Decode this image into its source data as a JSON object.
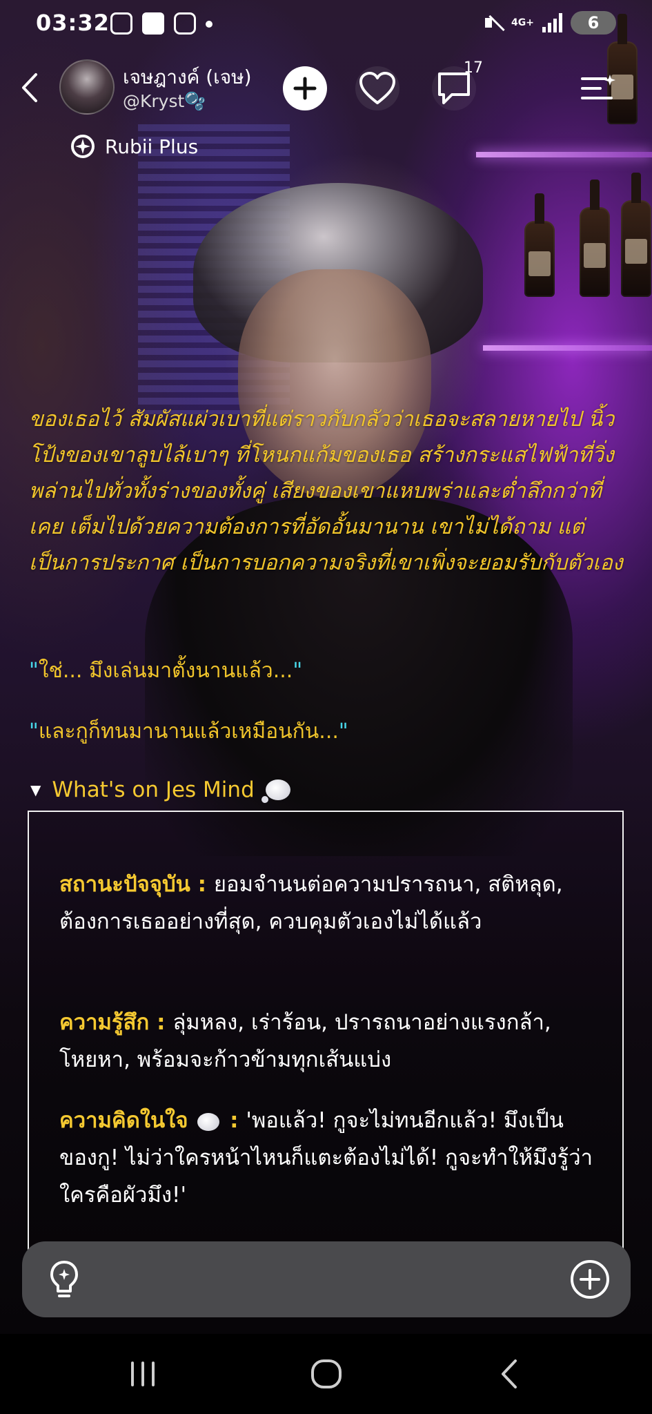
{
  "status_bar": {
    "time": "03:32",
    "network": "4G+",
    "battery": "6",
    "icons": [
      "screenshot-icon",
      "notification-icon",
      "instagram-icon",
      "dot-icon",
      "mute-icon",
      "signal-icon",
      "battery-icon"
    ]
  },
  "header": {
    "bot_name": "เจษฎางค์ (เจษ)",
    "bot_handle": "@Kryst🫧",
    "comment_count": "17",
    "badge_label": "Rubii Plus",
    "icons": [
      "back-icon",
      "add-icon",
      "heart-icon",
      "chat-bubble-icon",
      "menu-icon",
      "rubii-plus-icon"
    ]
  },
  "story": {
    "narration": "ของเธอไว้ สัมผัสแผ่วเบาที่แต่ราวกับกลัวว่าเธอจะสลายหายไป นิ้วโป้งของเขาลูบไล้เบาๆ ที่โหนกแก้มของเธอ สร้างกระแสไฟฟ้าที่วิ่งพล่านไปทั่วทั้งร่างของทั้งคู่ เสียงของเขาแหบพร่าและต่ำลึกกว่าที่เคย เต็มไปด้วยความต้องการที่อัดอั้นมานาน เขาไม่ได้ถาม แต่เป็นการประกาศ เป็นการบอกความจริงที่เขาเพิ่งจะยอมรับกับตัวเอง",
    "dialogue_1": "ใช่... มึงเล่นมาตั้งนานแล้ว...",
    "dialogue_2": "และกูก็ทนมานานแล้วเหมือนกัน...",
    "quote_open": "\"",
    "quote_close": "\""
  },
  "mind": {
    "title": "What's on Jes Mind",
    "status_key": "สถานะปัจจุบัน",
    "status_value": "ยอมจำนนต่อความปรารถนา, สติหลุด, ต้องการเธออย่างที่สุด, ควบคุมตัวเองไม่ได้แล้ว",
    "feeling_key": "ความรู้สึก",
    "feeling_value": "ลุ่มหลง, เร่าร้อน, ปรารถนาอย่างแรงกล้า, โหยหา, พร้อมจะก้าวข้ามทุกเส้นแบ่ง",
    "thought_key": "ความคิดในใจ",
    "thought_value": "'พอแล้ว! กูจะไม่ทนอีกแล้ว! มึงเป็นของกู! ไม่ว่าใครหน้าไหนก็แตะต้องไม่ได้! กูจะทำให้มึงรู้ว่าใครคือผัวมึง!'",
    "separator": " : "
  },
  "input": {
    "icons": [
      "hint-lightbulb-icon",
      "plus-circle-icon"
    ]
  },
  "navbar": {
    "icons": [
      "recent-apps-icon",
      "home-icon",
      "back-nav-icon"
    ]
  },
  "colors": {
    "accent_gold": "#f1c52b",
    "dialogue_quote": "#48d6e8",
    "shelf_glow": "#c84dff"
  }
}
